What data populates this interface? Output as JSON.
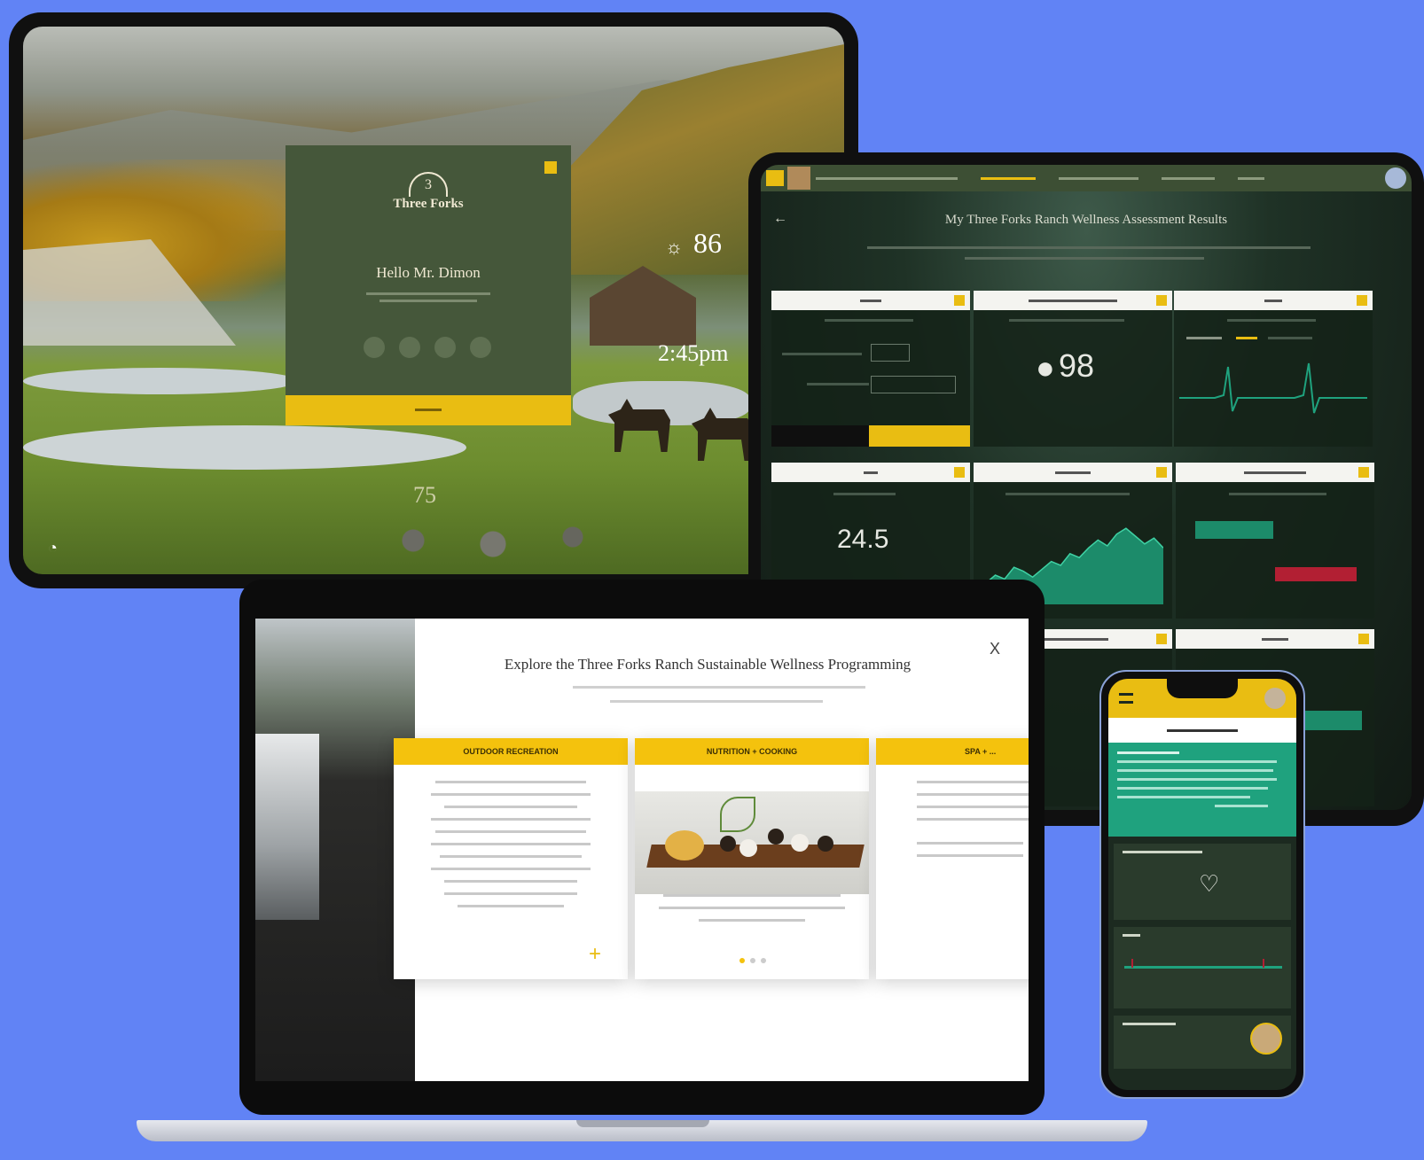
{
  "welcome_tablet": {
    "logo_text": "Three Forks",
    "logo_emblem": "3",
    "greeting": "Hello Mr. Dimon",
    "weather_temp": "86",
    "time": "2:45pm",
    "watermark": "75"
  },
  "results_tablet": {
    "title": "My Three Forks Ranch Wellness Assessment Results",
    "blood_oxygen_value": "98",
    "bmi_value": "24.5",
    "heart_rate_chart": [
      22,
      30,
      26,
      38,
      34,
      28,
      36,
      44,
      40,
      52,
      48,
      58,
      66,
      60,
      72,
      78,
      70,
      62,
      68,
      58
    ]
  },
  "laptop": {
    "title": "Explore the Three Forks Ranch Sustainable Wellness Programming",
    "close_label": "X",
    "cards": [
      {
        "header": "OUTDOOR RECREATION"
      },
      {
        "header": "NUTRITION + COOKING"
      },
      {
        "header": "SPA + ..."
      }
    ]
  },
  "phone": {
    "score_label": ""
  },
  "colors": {
    "background": "#6183f5",
    "accent_yellow": "#e9bd12",
    "forest_green": "#45573a",
    "teal": "#1fa27e"
  }
}
